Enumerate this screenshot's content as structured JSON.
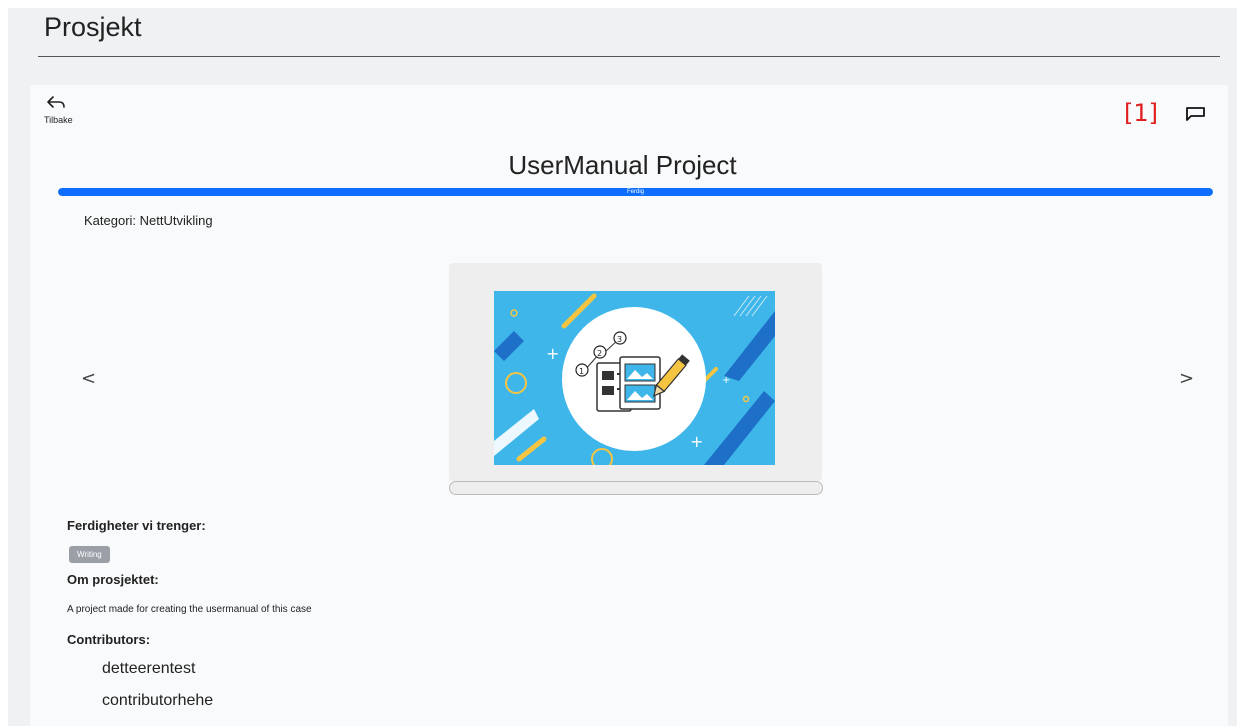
{
  "page": {
    "title": "Prosjekt"
  },
  "nav": {
    "back_label": "Tilbake"
  },
  "header": {
    "counter": "[1]"
  },
  "project": {
    "title": "UserManual Project",
    "status_label": "Ferdig",
    "progress": 1.0,
    "category": "Kategori: NettUtvikling"
  },
  "carousel": {
    "prev": "<",
    "next": ">"
  },
  "skills": {
    "heading": "Ferdigheter vi trenger:",
    "items": [
      "Writing"
    ]
  },
  "about": {
    "heading": "Om prosjektet:",
    "text": "A project made for creating the usermanual of this case"
  },
  "contributors": {
    "heading": "Contributors:",
    "items": [
      "detteerentest",
      "contributorhehe"
    ]
  },
  "colors": {
    "accent": "#0d6efd",
    "counter": "#e02020",
    "badge": "#9aa0a6"
  }
}
